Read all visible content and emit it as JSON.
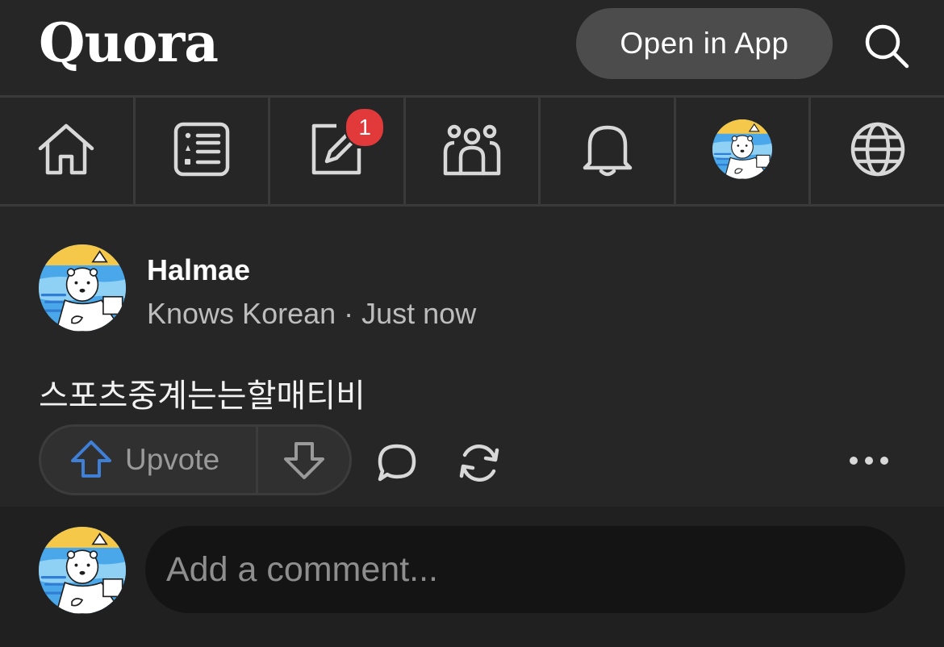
{
  "header": {
    "logo": "Quora",
    "open_app_label": "Open in App",
    "search_icon": "search-icon"
  },
  "nav": {
    "tabs": [
      {
        "icon": "home-icon"
      },
      {
        "icon": "following-list-icon"
      },
      {
        "icon": "answer-edit-icon",
        "badge": "1"
      },
      {
        "icon": "spaces-people-icon"
      },
      {
        "icon": "bell-icon"
      },
      {
        "icon": "profile-avatar"
      },
      {
        "icon": "globe-icon"
      }
    ]
  },
  "post": {
    "author": "Halmae",
    "meta": "Knows Korean · Just now",
    "body": "스포츠중계는는할매티비",
    "upvote_label": "Upvote"
  },
  "comment": {
    "placeholder": "Add a comment..."
  },
  "colors": {
    "background": "#181818",
    "surface": "#262626",
    "badge_red": "#e23a3a",
    "upvote_blue": "#3f7fd6",
    "input_bg": "#141414"
  }
}
